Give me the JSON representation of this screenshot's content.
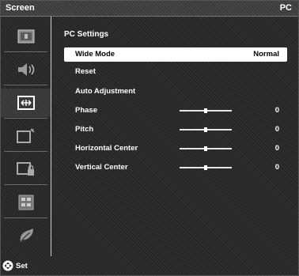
{
  "header": {
    "title": "Screen",
    "source": "PC"
  },
  "sidebar": {
    "items": [
      {
        "icon": "picture-icon",
        "active": false
      },
      {
        "icon": "speaker-icon",
        "active": false
      },
      {
        "icon": "screen-adjust-icon",
        "active": true
      },
      {
        "icon": "setup-icon",
        "active": false
      },
      {
        "icon": "lock-icon",
        "active": false
      },
      {
        "icon": "multi-screen-icon",
        "active": false
      },
      {
        "icon": "eco-leaf-icon",
        "active": false
      }
    ]
  },
  "settings": {
    "title": "PC Settings",
    "wide_mode": {
      "label": "Wide Mode",
      "value": "Normal"
    },
    "reset": {
      "label": "Reset"
    },
    "auto_adjustment": {
      "label": "Auto Adjustment"
    },
    "phase": {
      "label": "Phase",
      "value": "0",
      "level": 0.5
    },
    "pitch": {
      "label": "Pitch",
      "value": "0",
      "level": 0.5
    },
    "horizontal_center": {
      "label": "Horizontal Center",
      "value": "0",
      "level": 0.5
    },
    "vertical_center": {
      "label": "Vertical Center",
      "value": "0",
      "level": 0.5
    }
  },
  "footer": {
    "set_label": "Set",
    "icon": "dpad-icon"
  }
}
